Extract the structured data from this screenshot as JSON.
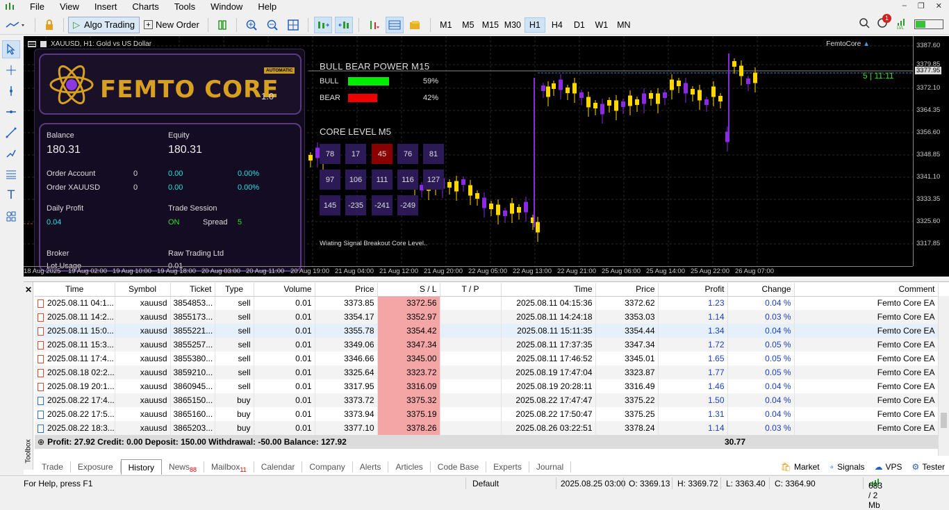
{
  "menu": [
    "File",
    "View",
    "Insert",
    "Charts",
    "Tools",
    "Window",
    "Help"
  ],
  "toolbar": {
    "algo_label": "Algo Trading",
    "new_order_label": "New Order",
    "timeframes": [
      "M1",
      "M5",
      "M15",
      "M30",
      "H1",
      "H4",
      "D1",
      "W1",
      "MN"
    ],
    "active_timeframe": "H1",
    "notif_count": "1"
  },
  "chart": {
    "title": "XAUUSD, H1:  Gold vs US Dollar",
    "ea_name": "FemtoCore",
    "timer": "5 | 11:11",
    "price_ticks": [
      "3387.60",
      "3379.85",
      "3377.95",
      "3372.10",
      "3364.35",
      "3356.60",
      "3348.85",
      "3341.10",
      "3333.35",
      "3325.60",
      "3317.85"
    ],
    "current_price": "3377.95",
    "time_ticks": [
      "18 Aug 2025",
      "19 Aug 02:00",
      "19 Aug 10:00",
      "19 Aug 18:00",
      "20 Aug 03:00",
      "20 Aug 11:00",
      "20 Aug 19:00",
      "21 Aug 04:00",
      "21 Aug 12:00",
      "21 Aug 20:00",
      "22 Aug 05:00",
      "22 Aug 13:00",
      "22 Aug 21:00",
      "25 Aug 06:00",
      "25 Aug 14:00",
      "25 Aug 22:00",
      "26 Aug 07:00"
    ],
    "colors": {
      "bull": "#ffd700",
      "bear": "#8a2be2",
      "background": "#000000"
    }
  },
  "panel": {
    "logo": "FEMTO CORE",
    "version": "1.0",
    "badge": "AUTOMATIC",
    "balance_label": "Balance",
    "balance": "180.31",
    "equity_label": "Equity",
    "equity": "180.31",
    "order_account_label": "Order Account",
    "order_account_count": "0",
    "order_account_value": "0.00",
    "order_account_pct": "0.00%",
    "order_xau_label": "Order XAUUSD",
    "order_xau_count": "0",
    "order_xau_value": "0.00",
    "order_xau_pct": "0.00%",
    "daily_profit_label": "Daily Profit",
    "daily_profit": "0.04",
    "trade_session_label": "Trade Session",
    "trade_session": "ON",
    "spread_label": "Spread",
    "spread": "5",
    "broker_label": "Broker",
    "broker": "Raw Trading Ltd",
    "lot_label": "Lot Usage",
    "lot": "0.01"
  },
  "bullbear": {
    "title": "BULL BEAR POWER M15",
    "bull_label": "BULL",
    "bull_pct": "59%",
    "bull_value": 59,
    "bear_label": "BEAR",
    "bear_pct": "42%",
    "bear_value": 42
  },
  "core": {
    "title": "CORE LEVEL M5",
    "cells": [
      "78",
      "17",
      "45",
      "76",
      "81",
      "97",
      "106",
      "111",
      "116",
      "127",
      "145",
      "-235",
      "-241",
      "-249"
    ],
    "waiting": "Wiating Signal Breakout Core Level.."
  },
  "history": {
    "headers": [
      "Time",
      "Symbol",
      "Ticket",
      "Type",
      "Volume",
      "Price",
      "S / L",
      "T / P",
      "Time",
      "Price",
      "Profit",
      "Change",
      "Comment"
    ],
    "rows": [
      {
        "time": "2025.08.11 04:1...",
        "symbol": "xauusd",
        "ticket": "3854853...",
        "type": "sell",
        "volume": "0.01",
        "price": "3373.85",
        "sl": "3372.56",
        "tp": "",
        "ctime": "2025.08.11 04:15:36",
        "cprice": "3372.62",
        "profit": "1.23",
        "change": "0.04 %",
        "comment": "Femto Core EA"
      },
      {
        "time": "2025.08.11 14:2...",
        "symbol": "xauusd",
        "ticket": "3855173...",
        "type": "sell",
        "volume": "0.01",
        "price": "3354.17",
        "sl": "3352.97",
        "tp": "",
        "ctime": "2025.08.11 14:24:18",
        "cprice": "3353.03",
        "profit": "1.14",
        "change": "0.03 %",
        "comment": "Femto Core EA"
      },
      {
        "time": "2025.08.11 15:0...",
        "symbol": "xauusd",
        "ticket": "3855221...",
        "type": "sell",
        "volume": "0.01",
        "price": "3355.78",
        "sl": "3354.42",
        "tp": "",
        "ctime": "2025.08.11 15:11:35",
        "cprice": "3354.44",
        "profit": "1.34",
        "change": "0.04 %",
        "comment": "Femto Core EA"
      },
      {
        "time": "2025.08.11 15:3...",
        "symbol": "xauusd",
        "ticket": "3855257...",
        "type": "sell",
        "volume": "0.01",
        "price": "3349.06",
        "sl": "3347.34",
        "tp": "",
        "ctime": "2025.08.11 17:37:35",
        "cprice": "3347.34",
        "profit": "1.72",
        "change": "0.05 %",
        "comment": "Femto Core EA"
      },
      {
        "time": "2025.08.11 17:4...",
        "symbol": "xauusd",
        "ticket": "3855380...",
        "type": "sell",
        "volume": "0.01",
        "price": "3346.66",
        "sl": "3345.00",
        "tp": "",
        "ctime": "2025.08.11 17:46:52",
        "cprice": "3345.01",
        "profit": "1.65",
        "change": "0.05 %",
        "comment": "Femto Core EA"
      },
      {
        "time": "2025.08.18 02:2...",
        "symbol": "xauusd",
        "ticket": "3859210...",
        "type": "sell",
        "volume": "0.01",
        "price": "3325.64",
        "sl": "3323.72",
        "tp": "",
        "ctime": "2025.08.19 17:47:04",
        "cprice": "3323.87",
        "profit": "1.77",
        "change": "0.05 %",
        "comment": "Femto Core EA"
      },
      {
        "time": "2025.08.19 20:1...",
        "symbol": "xauusd",
        "ticket": "3860945...",
        "type": "sell",
        "volume": "0.01",
        "price": "3317.95",
        "sl": "3316.09",
        "tp": "",
        "ctime": "2025.08.19 20:28:11",
        "cprice": "3316.49",
        "profit": "1.46",
        "change": "0.04 %",
        "comment": "Femto Core EA"
      },
      {
        "time": "2025.08.22 17:4...",
        "symbol": "xauusd",
        "ticket": "3865150...",
        "type": "buy",
        "volume": "0.01",
        "price": "3373.72",
        "sl": "3375.32",
        "tp": "",
        "ctime": "2025.08.22 17:47:47",
        "cprice": "3375.22",
        "profit": "1.50",
        "change": "0.04 %",
        "comment": "Femto Core EA"
      },
      {
        "time": "2025.08.22 17:5...",
        "symbol": "xauusd",
        "ticket": "3865160...",
        "type": "buy",
        "volume": "0.01",
        "price": "3373.94",
        "sl": "3375.19",
        "tp": "",
        "ctime": "2025.08.22 17:50:47",
        "cprice": "3375.25",
        "profit": "1.31",
        "change": "0.04 %",
        "comment": "Femto Core EA"
      },
      {
        "time": "2025.08.22 18:3...",
        "symbol": "xauusd",
        "ticket": "3865203...",
        "type": "buy",
        "volume": "0.01",
        "price": "3377.10",
        "sl": "3378.26",
        "tp": "",
        "ctime": "2025.08.26 03:22:51",
        "cprice": "3378.24",
        "profit": "1.14",
        "change": "0.03 %",
        "comment": "Femto Core EA"
      }
    ],
    "summary": "Profit: 27.92  Credit: 0.00  Deposit: 150.00  Withdrawal: -50.00  Balance: 127.92",
    "total": "30.77"
  },
  "tabs": [
    {
      "label": "Trade",
      "count": ""
    },
    {
      "label": "Exposure",
      "count": ""
    },
    {
      "label": "History",
      "count": ""
    },
    {
      "label": "News",
      "count": "88"
    },
    {
      "label": "Mailbox",
      "count": "11"
    },
    {
      "label": "Calendar",
      "count": ""
    },
    {
      "label": "Company",
      "count": ""
    },
    {
      "label": "Alerts",
      "count": ""
    },
    {
      "label": "Articles",
      "count": ""
    },
    {
      "label": "Code Base",
      "count": ""
    },
    {
      "label": "Experts",
      "count": ""
    },
    {
      "label": "Journal",
      "count": ""
    }
  ],
  "active_tab": "History",
  "tabs_right": [
    "Market",
    "Signals",
    "VPS",
    "Tester"
  ],
  "toolbox_label": "Toolbox",
  "status": {
    "help": "For Help, press F1",
    "profile": "Default",
    "datetime": "2025.08.25 03:00",
    "open": "O: 3369.13",
    "high": "H: 3369.72",
    "low": "L: 3363.40",
    "close": "C: 3364.90",
    "traffic": "683 / 2 Mb"
  }
}
